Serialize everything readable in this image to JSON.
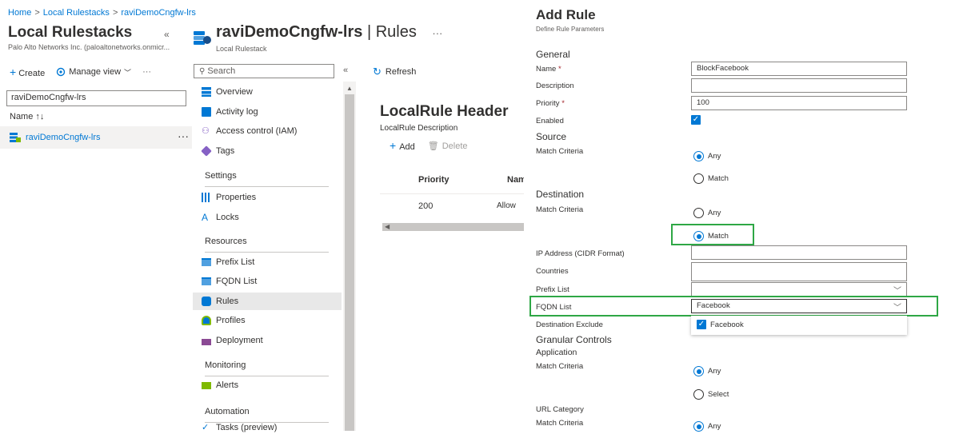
{
  "breadcrumb": {
    "home": "Home",
    "sep": ">",
    "item1": "Local Rulestacks",
    "item2": "raviDemoCngfw-lrs"
  },
  "left": {
    "title": "Local Rulestacks",
    "collapse": "«",
    "subtitle": "Palo Alto Networks Inc. (paloaltonetworks.onmicr...",
    "toolbar": {
      "create": "Create",
      "manage_view": "Manage view",
      "more": "···"
    },
    "filter_value": "raviDemoCngfw-lrs",
    "column_name": "Name ↑↓",
    "row": {
      "name": "raviDemoCngfw-lrs",
      "more": "···"
    }
  },
  "resource": {
    "name": "raviDemoCngfw-lrs",
    "page": "| Rules",
    "more": "···",
    "type": "Local Rulestack"
  },
  "nav": {
    "search_placeholder": "Search",
    "collapse": "«",
    "items": {
      "overview": "Overview",
      "activity_log": "Activity log",
      "access_control": "Access control (IAM)",
      "tags": "Tags",
      "properties": "Properties",
      "locks": "Locks",
      "prefix_list": "Prefix List",
      "fqdn_list": "FQDN List",
      "rules": "Rules",
      "profiles": "Profiles",
      "deployment": "Deployment",
      "alerts": "Alerts",
      "tasks": "Tasks (preview)"
    },
    "sections": {
      "settings": "Settings",
      "resources": "Resources",
      "monitoring": "Monitoring",
      "automation": "Automation"
    }
  },
  "content": {
    "refresh": "Refresh",
    "header": "LocalRule Header",
    "description": "LocalRule Description",
    "add": "Add",
    "delete": "Delete",
    "columns": {
      "priority": "Priority",
      "name": "Nam"
    },
    "rows": [
      {
        "priority": "200",
        "name": "Allow"
      }
    ]
  },
  "panel": {
    "title": "Add Rule",
    "subtitle": "Define Rule Parameters",
    "general": "General",
    "name_label": "Name",
    "name_value": "BlockFacebook",
    "description_label": "Description",
    "description_value": "",
    "priority_label": "Priority",
    "priority_value": "100",
    "enabled_label": "Enabled",
    "enabled": true,
    "required_mark": "*",
    "source": "Source",
    "source_match_criteria": "Match Criteria",
    "source_any": "Any",
    "source_match": "Match",
    "destination": "Destination",
    "dest_match_criteria": "Match Criteria",
    "dest_any": "Any",
    "dest_match": "Match",
    "ip_label": "IP Address (CIDR Format)",
    "countries_label": "Countries",
    "prefix_label": "Prefix List",
    "prefix_value": "",
    "fqdn_label": "FQDN List",
    "fqdn_value": "Facebook",
    "fqdn_option": "Facebook",
    "dest_exclude_label": "Destination Exclude",
    "granular": "Granular Controls",
    "application": "Application",
    "app_match_criteria": "Match Criteria",
    "app_any": "Any",
    "app_select": "Select",
    "url_category": "URL Category",
    "url_match_criteria": "Match Criteria",
    "url_any": "Any"
  },
  "colors": {
    "accent": "#0078d4",
    "highlight": "#2ea745"
  }
}
